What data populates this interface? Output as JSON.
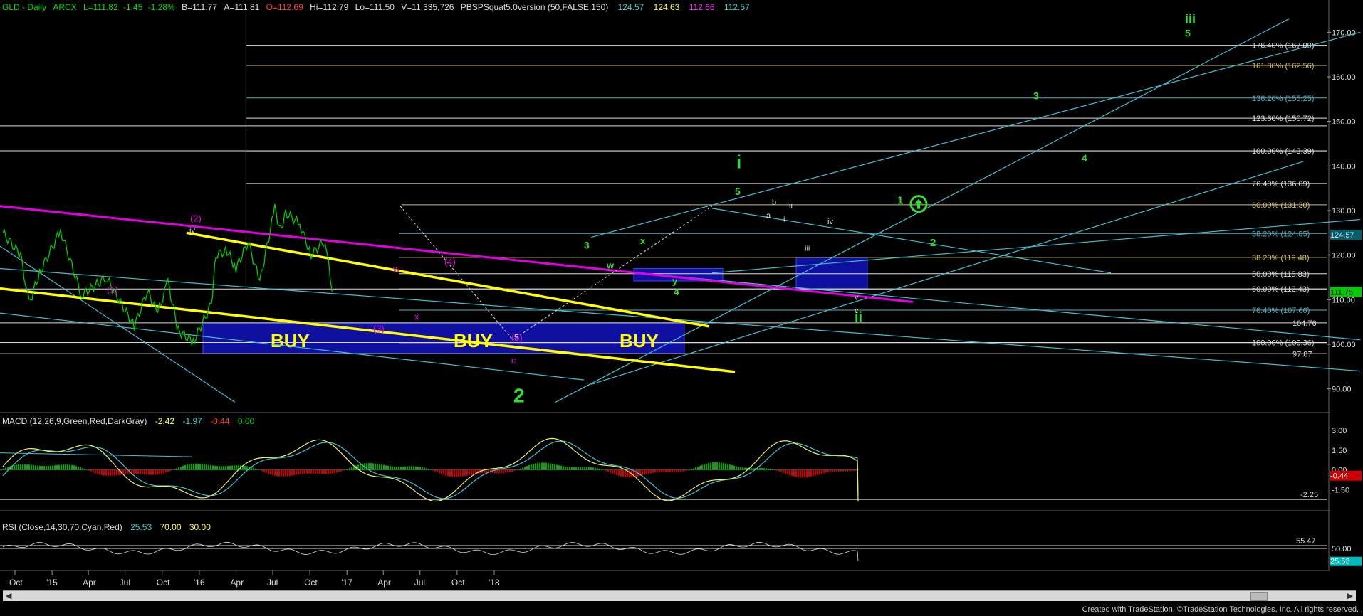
{
  "header": {
    "symbol": "GLD - Daily",
    "exchange": "ARCX",
    "last": "L=111.82",
    "change": "-1.45",
    "change_pct": "-1.28%",
    "bid": "B=111.77",
    "ask": "A=111.81",
    "open": "O=112.69",
    "high": "Hi=112.79",
    "low": "Lo=111.50",
    "volume": "V=11,335,726",
    "study": "PBSPSquat5.0version (50,FALSE,150)",
    "study_values": [
      "124.57",
      "124.63",
      "112.66",
      "112.57"
    ]
  },
  "colors": {
    "background": "#000000",
    "price_bars": "#00cc00",
    "magenta": "#e000e0",
    "yellow": "#ffff00",
    "cyan": "#40c0d0",
    "green_labels": "#33dd33",
    "buy_box": "#1010a0",
    "macd_up": "#00aa00",
    "macd_down": "#cc0000",
    "last_price_tag": "#00cc00",
    "rsi_tag": "#00bbbb"
  },
  "chart_data": [
    {
      "type": "line",
      "title": "GLD - Daily",
      "ylim": [
        85,
        175
      ],
      "y_ticks": [
        "170.00",
        "160.00",
        "150.00",
        "140.00",
        "130.00",
        "120.00",
        "110.00",
        "100.00",
        "90.00"
      ],
      "x_ticks": [
        "Oct",
        "'15",
        "Apr",
        "Jul",
        "Oct",
        "'16",
        "Apr",
        "Jul",
        "Oct",
        "'17",
        "Apr",
        "Jul",
        "Oct",
        "'18"
      ],
      "close_points": [
        {
          "x": "2014-09-01",
          "y": 125
        },
        {
          "x": "2014-10-15",
          "y": 120
        },
        {
          "x": "2014-11-05",
          "y": 109
        },
        {
          "x": "2014-12-01",
          "y": 116
        },
        {
          "x": "2015-01-22",
          "y": 125.5
        },
        {
          "x": "2015-03-15",
          "y": 111
        },
        {
          "x": "2015-05-15",
          "y": 115
        },
        {
          "x": "2015-07-24",
          "y": 104
        },
        {
          "x": "2015-08-25",
          "y": 112
        },
        {
          "x": "2015-09-20",
          "y": 107
        },
        {
          "x": "2015-10-15",
          "y": 114
        },
        {
          "x": "2015-11-10",
          "y": 103
        },
        {
          "x": "2015-12-17",
          "y": 100.5
        },
        {
          "x": "2016-01-31",
          "y": 109
        },
        {
          "x": "2016-02-11",
          "y": 120
        },
        {
          "x": "2016-03-10",
          "y": 121
        },
        {
          "x": "2016-04-01",
          "y": 117
        },
        {
          "x": "2016-05-01",
          "y": 123
        },
        {
          "x": "2016-05-30",
          "y": 114
        },
        {
          "x": "2016-07-06",
          "y": 130.5
        },
        {
          "x": "2016-07-20",
          "y": 125.5
        },
        {
          "x": "2016-08-02",
          "y": 129.5
        },
        {
          "x": "2016-09-06",
          "y": 127
        },
        {
          "x": "2016-10-04",
          "y": 120
        },
        {
          "x": "2016-11-08",
          "y": 123.5
        },
        {
          "x": "2016-11-25",
          "y": 111.8
        }
      ],
      "fib_levels": [
        {
          "label": "176.40% (167.09)",
          "value": 167.09
        },
        {
          "label": "161.80% (162.56)",
          "value": 162.56
        },
        {
          "label": "138.20% (155.25)",
          "value": 155.25
        },
        {
          "label": "123.60% (150.72)",
          "value": 150.72
        },
        {
          "label": "100.00% (143.39)",
          "value": 143.39
        },
        {
          "label": "76.40% (136.09)",
          "value": 136.09
        },
        {
          "label": "60.00% (131.30)",
          "value": 131.3
        },
        {
          "label": "38.20% (124.85)",
          "value": 124.85
        },
        {
          "label": "38.20% (119.48)",
          "value": 119.48
        },
        {
          "label": "50.00% (115.83)",
          "value": 115.83
        },
        {
          "label": "60.00% (112.43)",
          "value": 112.43
        },
        {
          "label": "76.40% (107.66)",
          "value": 107.66
        },
        {
          "label": "100.00% (100.36)",
          "value": 100.36
        }
      ],
      "price_tags": [
        "124.57",
        "111.75",
        "104.76",
        "97.87"
      ],
      "wave_labels": {
        "magenta": [
          "(1)",
          "(2)",
          "(3)",
          "(4)",
          "(5)",
          "w",
          "x",
          "c"
        ],
        "green": [
          "2",
          "3",
          "4",
          "5",
          "i",
          "ii",
          "iii",
          "1",
          "2",
          "3",
          "4",
          "5",
          "x",
          "w",
          "y",
          "4"
        ],
        "white": [
          "iv",
          "a",
          "b",
          "i",
          "ii",
          "iii",
          "iv",
          "v",
          "c",
          "5"
        ]
      },
      "buy_zones": [
        "BUY",
        "BUY",
        "BUY"
      ]
    },
    {
      "type": "line",
      "title": "MACD (12,26,9,Green,Red,DarkGray)",
      "values_header": [
        "-2.42",
        "-1.97",
        "-0.44",
        "0.00"
      ],
      "ylim": [
        -3,
        3.5
      ],
      "y_ticks": [
        "3.00",
        "1.50",
        "0.00",
        "-1.50"
      ],
      "tags": [
        "-0.44",
        "-2.25"
      ]
    },
    {
      "type": "line",
      "title": "RSI (Close,14,30,70,Cyan,Red)",
      "values_header": [
        "25.53",
        "70.00",
        "30.00"
      ],
      "y_ticks": [
        "50.00"
      ],
      "tags": [
        "55.47",
        "25.53"
      ]
    }
  ],
  "footer": "Created with TradeStation. ©TradeStation Technologies, Inc. All rights reserved."
}
